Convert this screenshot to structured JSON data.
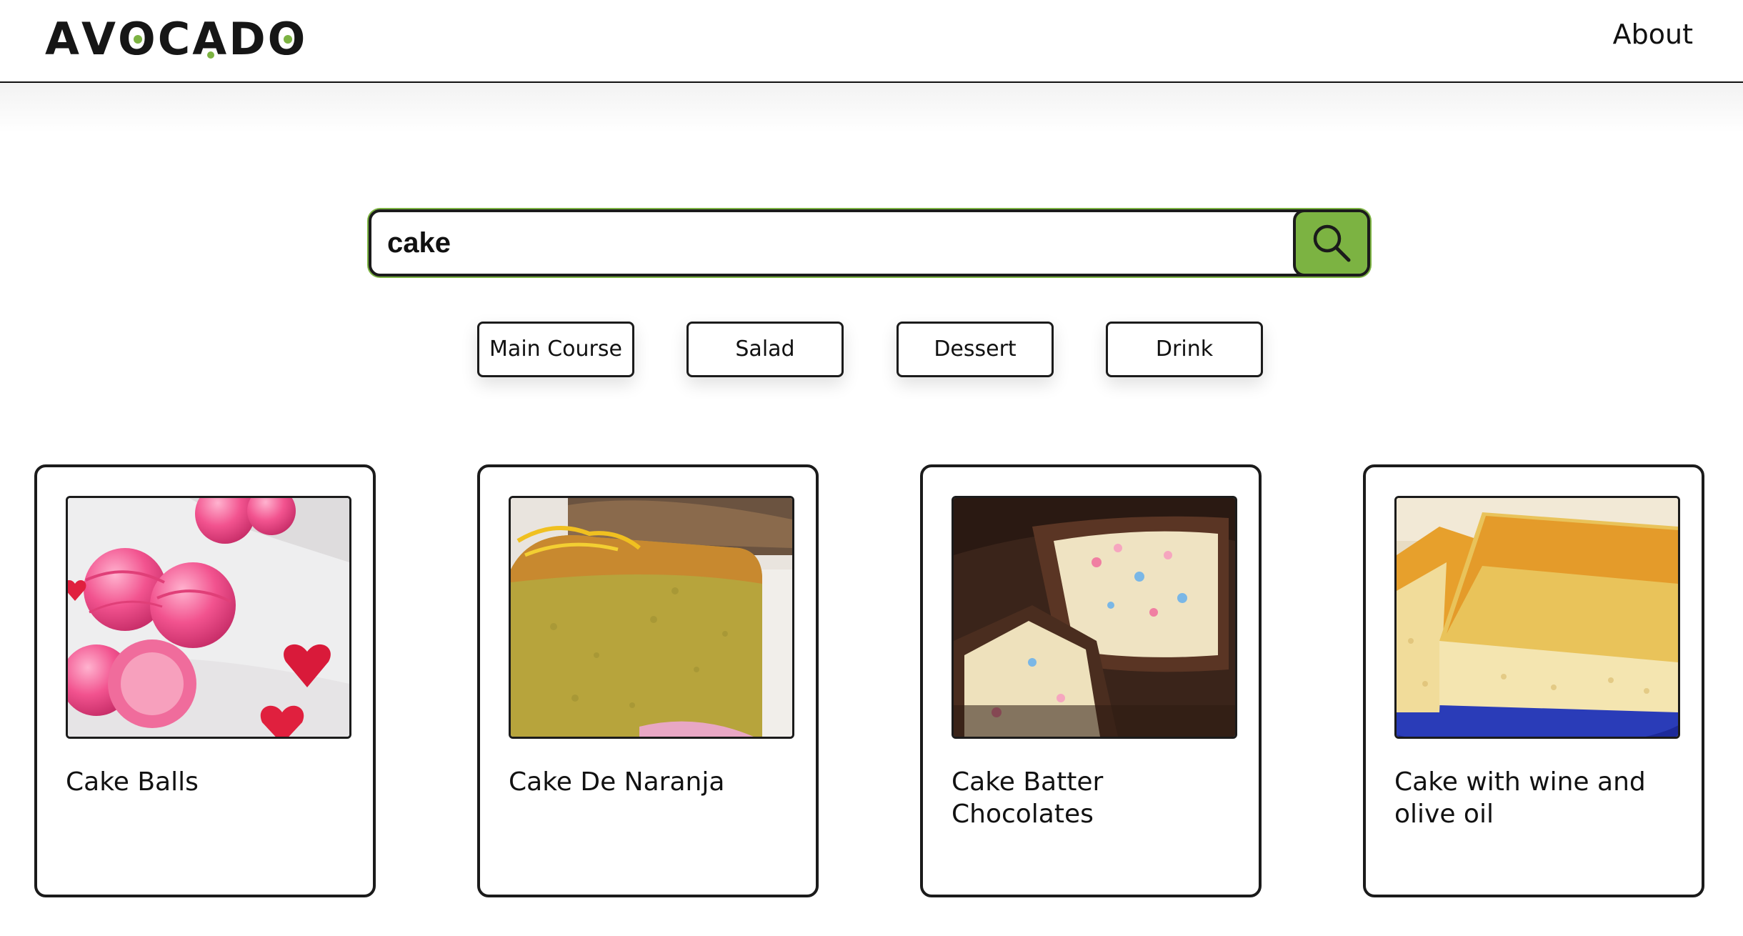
{
  "theme": {
    "accent": "#7cb342"
  },
  "header": {
    "logo_text": "AVOCADO",
    "about_label": "About"
  },
  "search": {
    "value": "cake",
    "button_icon": "search-icon"
  },
  "categories": [
    {
      "label": "Main Course"
    },
    {
      "label": "Salad"
    },
    {
      "label": "Dessert"
    },
    {
      "label": "Drink"
    }
  ],
  "results": [
    {
      "title": "Cake Balls",
      "image": "cake-balls-photo"
    },
    {
      "title": "Cake De Naranja",
      "image": "orange-cake-photo"
    },
    {
      "title": "Cake Batter Chocolates",
      "image": "cake-batter-chocolates-photo"
    },
    {
      "title": "Cake with wine and olive oil",
      "image": "wine-olive-oil-cake-photo"
    }
  ]
}
